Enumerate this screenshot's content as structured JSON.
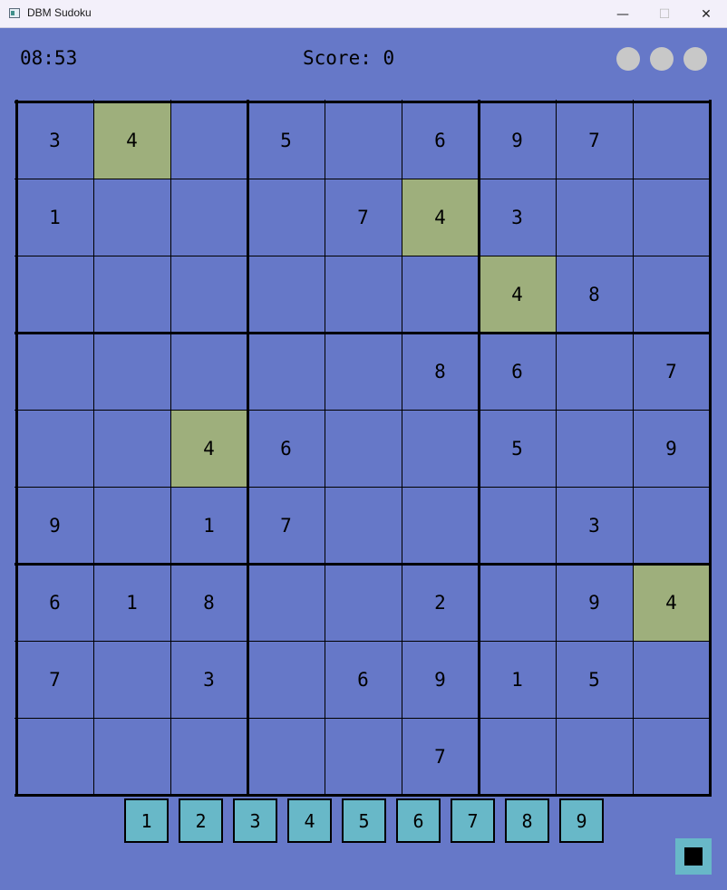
{
  "window": {
    "title": "DBM Sudoku",
    "minimize_icon": "—",
    "maximize_icon": "☐",
    "close_icon": "✕"
  },
  "header": {
    "timer": "08:53",
    "score": "Score: 0",
    "lives": 3
  },
  "board": {
    "rows": [
      [
        "3",
        "4",
        "",
        "5",
        "",
        "6",
        "9",
        "7",
        ""
      ],
      [
        "1",
        "",
        "",
        "",
        "7",
        "4",
        "3",
        "",
        ""
      ],
      [
        "",
        "",
        "",
        "",
        "",
        "",
        "4",
        "8",
        ""
      ],
      [
        "",
        "",
        "",
        "",
        "",
        "8",
        "6",
        "",
        "7"
      ],
      [
        "",
        "",
        "4",
        "6",
        "",
        "",
        "5",
        "",
        "9"
      ],
      [
        "9",
        "",
        "1",
        "7",
        "",
        "",
        "",
        "3",
        ""
      ],
      [
        "6",
        "1",
        "8",
        "",
        "",
        "2",
        "",
        "9",
        "4"
      ],
      [
        "7",
        "",
        "3",
        "",
        "6",
        "9",
        "1",
        "5",
        ""
      ],
      [
        "",
        "",
        "",
        "",
        "",
        "7",
        "",
        "",
        ""
      ]
    ],
    "highlight_digit": "4"
  },
  "number_pad": [
    "1",
    "2",
    "3",
    "4",
    "5",
    "6",
    "7",
    "8",
    "9"
  ],
  "colors": {
    "background": "#6678c8",
    "highlight": "#9eaf7c",
    "button": "#68b8c8",
    "life": "#c8c8c8"
  }
}
